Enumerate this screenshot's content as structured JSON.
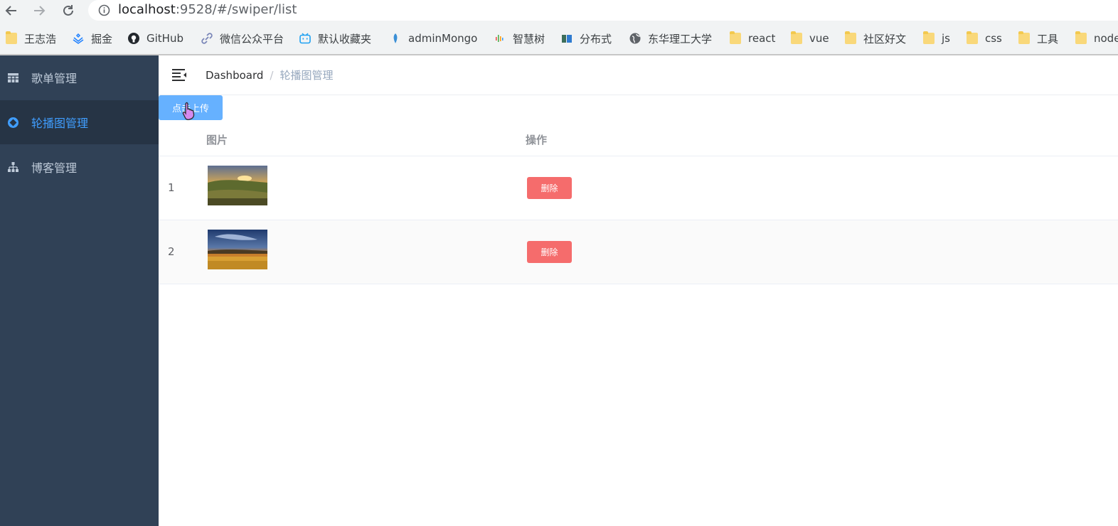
{
  "browser": {
    "url_host": "localhost",
    "url_path": ":9528/#/swiper/list",
    "bookmarks": [
      {
        "label": "王志浩",
        "icon": "folder-icon"
      },
      {
        "label": "掘金",
        "icon": "juejin-icon"
      },
      {
        "label": "GitHub",
        "icon": "github-icon"
      },
      {
        "label": "微信公众平台",
        "icon": "link-icon"
      },
      {
        "label": "默认收藏夹",
        "icon": "bilibili-icon"
      },
      {
        "label": "adminMongo",
        "icon": "mongo-leaf-icon"
      },
      {
        "label": "智慧树",
        "icon": "zhihuishu-icon"
      },
      {
        "label": "分布式",
        "icon": "book-icon"
      },
      {
        "label": "东华理工大学",
        "icon": "globe-icon"
      },
      {
        "label": "react",
        "icon": "folder-icon"
      },
      {
        "label": "vue",
        "icon": "folder-icon"
      },
      {
        "label": "社区好文",
        "icon": "folder-icon"
      },
      {
        "label": "js",
        "icon": "folder-icon"
      },
      {
        "label": "css",
        "icon": "folder-icon"
      },
      {
        "label": "工具",
        "icon": "folder-icon"
      },
      {
        "label": "node",
        "icon": "folder-icon"
      }
    ]
  },
  "sidebar": {
    "items": [
      {
        "label": "歌单管理",
        "icon": "table-icon",
        "active": false
      },
      {
        "label": "轮播图管理",
        "icon": "swiper-icon",
        "active": true
      },
      {
        "label": "博客管理",
        "icon": "tree-icon",
        "active": false
      }
    ]
  },
  "navbar": {
    "breadcrumb": [
      "Dashboard",
      "轮播图管理"
    ],
    "separator": "/"
  },
  "main": {
    "upload_label": "点击上传",
    "table": {
      "columns": [
        "图片",
        "操作"
      ],
      "rows": [
        {
          "index": "1",
          "delete_label": "删除"
        },
        {
          "index": "2",
          "delete_label": "删除"
        }
      ]
    }
  },
  "colors": {
    "sidebar_bg": "#304156",
    "active_text": "#409eff",
    "upload_button": "#66b1ff",
    "delete_button": "#f56c6c"
  }
}
